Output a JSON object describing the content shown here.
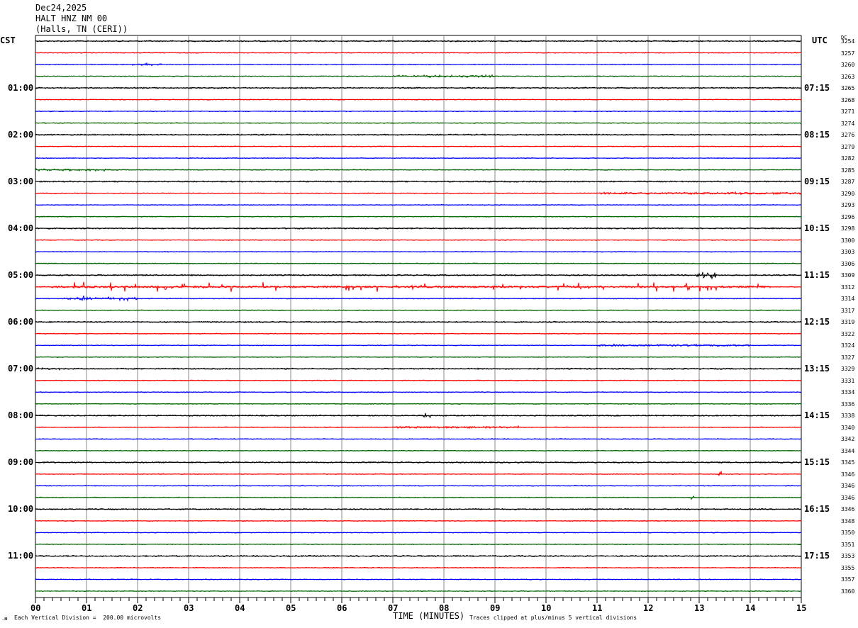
{
  "header": {
    "date": "Dec24,2025",
    "station": "HALT HNZ NM 00",
    "location": "(Halls, TN (CERI))"
  },
  "left_axis_title": "CST",
  "right_axis_title": "UTC",
  "dc_title": "DC",
  "footer": {
    "scale": "Each Vertical Division =  200.00 microvolts",
    "xlabel": "TIME (MINUTES)",
    "clip_note": "Traces clipped at plus/minus 5 vertical divisions"
  },
  "chart_data": {
    "type": "line",
    "title": "HALT HNZ NM 00 helicorder",
    "xlabel": "TIME (MINUTES)",
    "xlim": [
      0,
      15
    ],
    "x_ticks": [
      "00",
      "01",
      "02",
      "03",
      "04",
      "05",
      "06",
      "07",
      "08",
      "09",
      "10",
      "11",
      "12",
      "13",
      "14",
      "15"
    ],
    "grid": true,
    "trace_colors": [
      "#000000",
      "#ff0000",
      "#0000ff",
      "#006400"
    ],
    "left_labels": [
      "01:00",
      "02:00",
      "03:00",
      "04:00",
      "05:00",
      "06:00",
      "07:00",
      "08:00",
      "09:00",
      "10:00",
      "11:00"
    ],
    "right_labels": [
      "07:15",
      "08:15",
      "09:15",
      "10:15",
      "11:15",
      "12:15",
      "13:15",
      "14:15",
      "15:15",
      "16:15",
      "17:15"
    ],
    "dc_values": [
      "3254",
      "3257",
      "3260",
      "3263",
      "3265",
      "3268",
      "3271",
      "3274",
      "3276",
      "3279",
      "3282",
      "3285",
      "3287",
      "3290",
      "3293",
      "3296",
      "3298",
      "3300",
      "3303",
      "3306",
      "3309",
      "3312",
      "3314",
      "3317",
      "3319",
      "3322",
      "3324",
      "3327",
      "3329",
      "3331",
      "3334",
      "3336",
      "3338",
      "3340",
      "3342",
      "3344",
      "3345",
      "3346",
      "3346",
      "3346",
      "3346",
      "3348",
      "3350",
      "3351",
      "3353",
      "3355",
      "3357",
      "3360"
    ],
    "events": [
      {
        "row": 2,
        "start": 1.9,
        "end": 2.5,
        "amplitude": 2
      },
      {
        "row": 3,
        "start": 7.0,
        "end": 9.0,
        "amplitude": 2
      },
      {
        "row": 11,
        "start": 0.0,
        "end": 1.5,
        "amplitude": 2
      },
      {
        "row": 13,
        "start": 11.0,
        "end": 15.0,
        "amplitude": 2
      },
      {
        "row": 22,
        "start": 0.5,
        "end": 2.0,
        "amplitude": 3
      },
      {
        "row": 20,
        "start": 12.95,
        "end": 13.35,
        "amplitude": 6
      },
      {
        "row": 21,
        "start": 0.3,
        "end": 14.4,
        "amplitude": 7
      },
      {
        "row": 22,
        "start": 0.85,
        "end": 0.95,
        "amplitude": 5
      },
      {
        "row": 26,
        "start": 11.0,
        "end": 14.0,
        "amplitude": 2
      },
      {
        "row": 28,
        "start": 0.0,
        "end": 0.5,
        "amplitude": 2
      },
      {
        "row": 32,
        "start": 7.6,
        "end": 7.75,
        "amplitude": 7
      },
      {
        "row": 33,
        "start": 7.0,
        "end": 9.5,
        "amplitude": 2
      },
      {
        "row": 37,
        "start": 13.38,
        "end": 13.45,
        "amplitude": 6
      },
      {
        "row": 39,
        "start": 12.82,
        "end": 12.9,
        "amplitude": 5
      }
    ]
  }
}
